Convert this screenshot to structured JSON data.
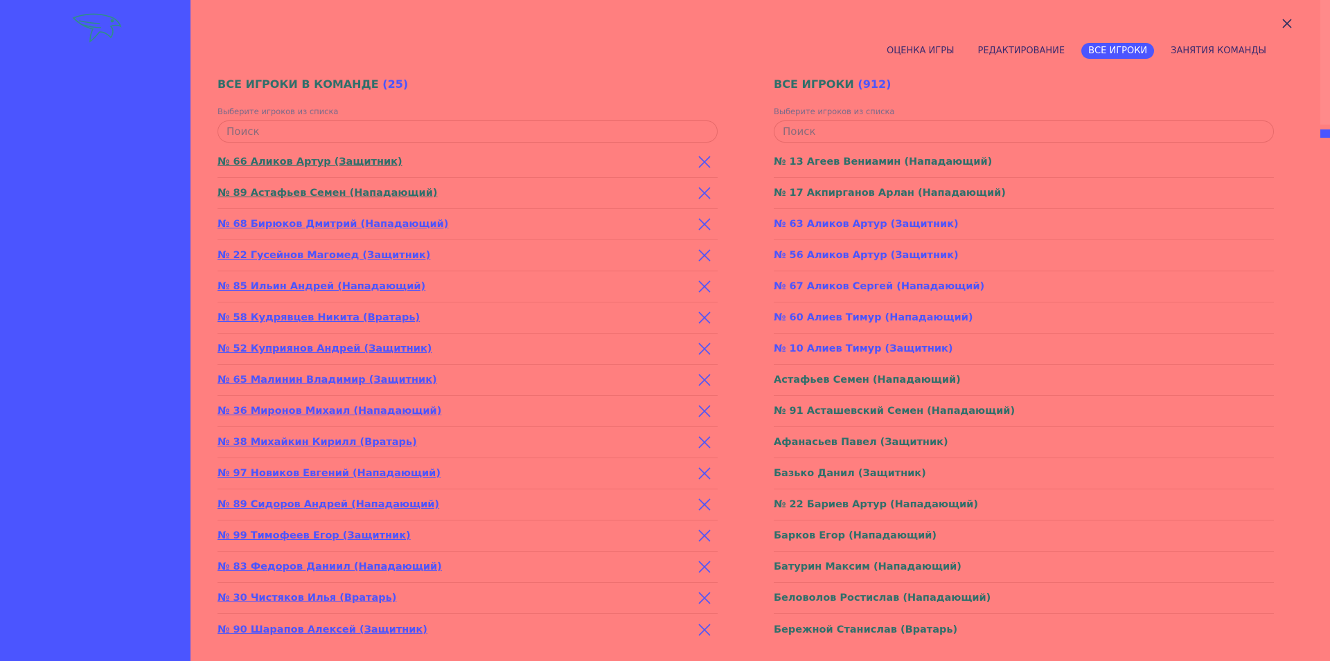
{
  "sidebar": {
    "logo_icon": "eagle-logo-icon"
  },
  "header": {
    "close_icon": "close-icon",
    "tabs": [
      {
        "label": "ОЦЕНКА ИГРЫ",
        "active": false
      },
      {
        "label": "РЕДАКТИРОВАНИЕ",
        "active": false
      },
      {
        "label": "ВСЕ ИГРОКИ",
        "active": true
      },
      {
        "label": "ЗАНЯТИЯ КОМАНДЫ",
        "active": false
      }
    ]
  },
  "team_players": {
    "title": "ВСЕ ИГРОКИ В КОМАНДЕ",
    "count": "(25)",
    "hint": "Выберите игроков из списка",
    "search_placeholder": "Поиск",
    "remove_icon": "remove-x-icon",
    "items": [
      {
        "label": "№ 66 Аликов Артур (Защитник)",
        "overlap": false
      },
      {
        "label": "№ 89 Астафьев Семен (Нападающий)",
        "overlap": false
      },
      {
        "label": "№ 68 Бирюков Дмитрий (Нападающий)",
        "overlap": true
      },
      {
        "label": "№ 22 Гусейнов Магомед (Защитник)",
        "overlap": true
      },
      {
        "label": "№ 85 Ильин Андрей (Нападающий)",
        "overlap": true
      },
      {
        "label": "№ 58 Кудрявцев Никита (Вратарь)",
        "overlap": true
      },
      {
        "label": "№ 52 Куприянов Андрей (Защитник)",
        "overlap": true
      },
      {
        "label": "№ 65 Малинин Владимир (Защитник)",
        "overlap": true
      },
      {
        "label": "№ 36 Миронов Михаил (Нападающий)",
        "overlap": true
      },
      {
        "label": "№ 38 Михайкин Кирилл (Вратарь)",
        "overlap": true
      },
      {
        "label": "№ 97 Новиков Евгений (Нападающий)",
        "overlap": true
      },
      {
        "label": "№ 89 Сидоров Андрей (Нападающий)",
        "overlap": true
      },
      {
        "label": "№ 99 Тимофеев Егор (Защитник)",
        "overlap": true
      },
      {
        "label": "№ 83 Федоров Даниил (Нападающий)",
        "overlap": true
      },
      {
        "label": "№ 30 Чистяков Илья (Вратарь)",
        "overlap": true
      },
      {
        "label": "№ 90 Шарапов Алексей (Защитник)",
        "overlap": true
      }
    ]
  },
  "all_players": {
    "title": "ВСЕ ИГРОКИ",
    "count": "(912)",
    "hint": "Выберите игроков из списка",
    "search_placeholder": "Поиск",
    "items": [
      {
        "label": "№ 13 Агеев Вениамин (Нападающий)",
        "overlap": false
      },
      {
        "label": "№ 17 Акпирганов Арлан (Нападающий)",
        "overlap": false
      },
      {
        "label": "№ 63 Аликов Артур (Защитник)",
        "overlap": true
      },
      {
        "label": "№ 56 Аликов Артур (Защитник)",
        "overlap": true
      },
      {
        "label": "№ 67 Аликов Сергей (Нападающий)",
        "overlap": true
      },
      {
        "label": "№ 60 Алиев Тимур (Нападающий)",
        "overlap": true
      },
      {
        "label": "№ 10 Алиев Тимур (Защитник)",
        "overlap": true
      },
      {
        "label": "Астафьев Семен (Нападающий)",
        "overlap": false
      },
      {
        "label": "№ 91 Асташевский Семен (Нападающий)",
        "overlap": false
      },
      {
        "label": "Афанасьев Павел (Защитник)",
        "overlap": false
      },
      {
        "label": "Базько Данил (Защитник)",
        "overlap": false
      },
      {
        "label": "№ 22 Бариев Артур (Нападающий)",
        "overlap": false
      },
      {
        "label": "Барков Егор (Нападающий)",
        "overlap": false
      },
      {
        "label": "Батурин Максим (Нападающий)",
        "overlap": false
      },
      {
        "label": "Беловолов Ростислав (Нападающий)",
        "overlap": false
      },
      {
        "label": "Бережной Станислав (Вратарь)",
        "overlap": false
      }
    ]
  },
  "colors": {
    "sidebar_bg": "#4b55ff",
    "main_bg": "#ff7f7f",
    "text_primary": "#2f6f6a",
    "accent": "#4b55ff"
  }
}
